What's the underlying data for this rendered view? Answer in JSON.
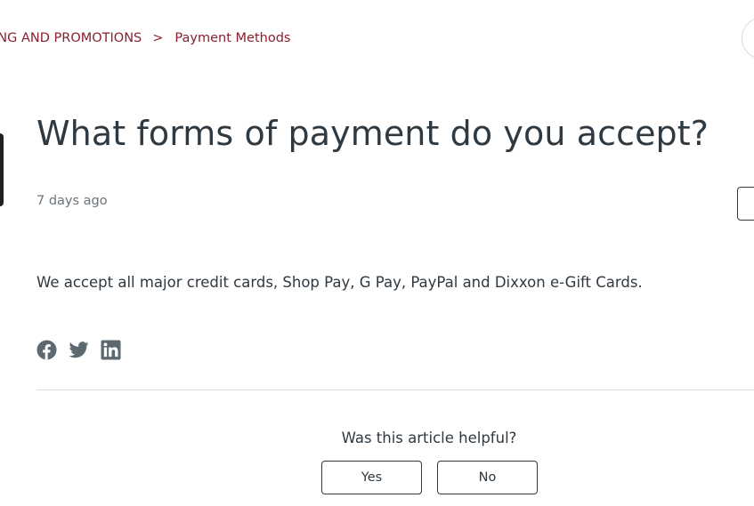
{
  "breadcrumb": {
    "items": [
      {
        "label": "ING AND PROMOTIONS"
      },
      {
        "label": "Payment Methods"
      }
    ],
    "separator": ">"
  },
  "article": {
    "title": "What forms of payment do you accept?",
    "posted": "7 days ago",
    "body": "We accept all major credit cards, Shop Pay, G Pay, PayPal and Dixxon e-Gift Cards."
  },
  "share": {
    "icons": [
      "facebook-icon",
      "twitter-icon",
      "linkedin-icon"
    ],
    "icon_color": "#5c6970"
  },
  "feedback": {
    "question": "Was this article helpful?",
    "yes_label": "Yes",
    "no_label": "No"
  },
  "colors": {
    "breadcrumb": "#8a1f2e",
    "text": "#2f3941",
    "muted": "#68737d",
    "divider": "#d8dcde"
  }
}
